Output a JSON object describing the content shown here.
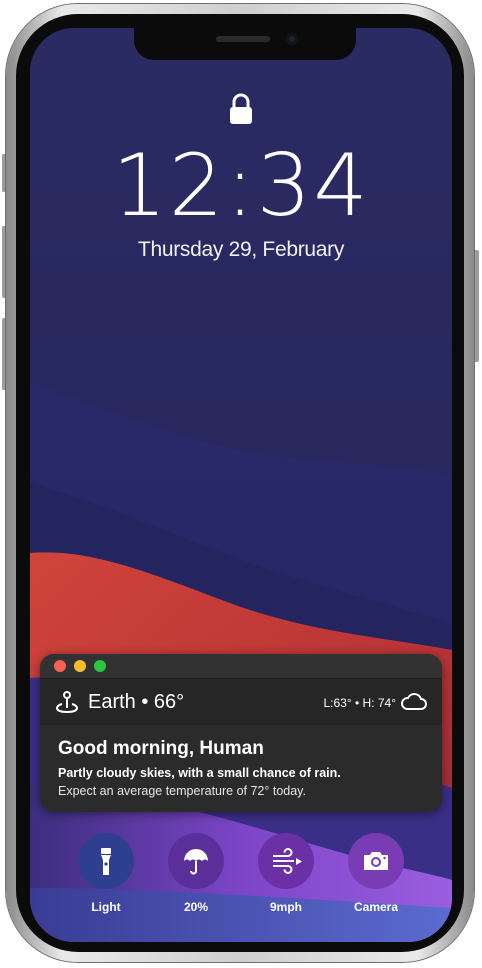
{
  "lockscreen": {
    "time": "12:34",
    "date": "Thursday 29, February"
  },
  "widget": {
    "location": "Earth • 66°",
    "low_high": "L:63° • H: 74°",
    "greeting": "Good morning, Human",
    "summary": "Partly cloudy skies, with a small chance of rain.",
    "detail": "Expect an average temperature of 72° today."
  },
  "actions": [
    {
      "label": "Light",
      "icon": "flashlight-icon"
    },
    {
      "label": "20%",
      "icon": "umbrella-icon"
    },
    {
      "label": "9mph",
      "icon": "wind-icon"
    },
    {
      "label": "Camera",
      "icon": "camera-icon"
    }
  ],
  "colors": {
    "traffic_red": "#fe5f57",
    "traffic_yellow": "#febc2e",
    "traffic_green": "#28c840",
    "wallpaper_dark": "#28285e",
    "wallpaper_red": "#c6403a",
    "wallpaper_purple": "#8b4fd1"
  }
}
